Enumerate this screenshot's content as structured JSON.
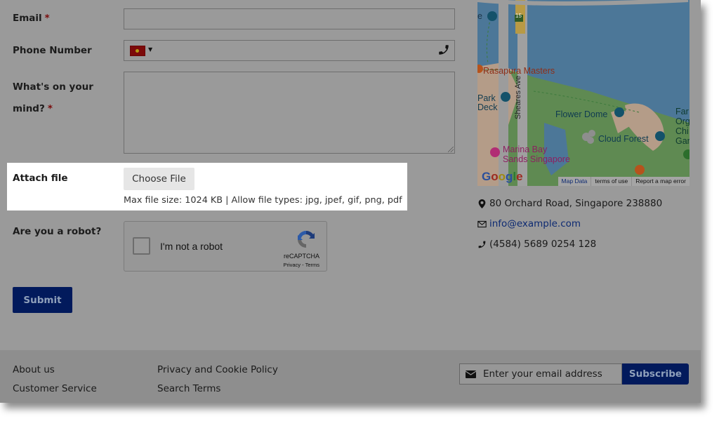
{
  "form": {
    "email": {
      "label": "Email",
      "required_mark": "*",
      "value": ""
    },
    "phone": {
      "label": "Phone Number",
      "country_flag": "vietnam-flag",
      "value": ""
    },
    "message": {
      "label_line1": "What's on your",
      "label_line2": "mind?",
      "required_mark": "*",
      "value": ""
    },
    "attach": {
      "label": "Attach file",
      "button_label": "Choose File",
      "hint": "Max file size: 1024 KB | Allow file types: jpg, jpef, gif, png, pdf"
    },
    "robot": {
      "label": "Are you a robot?",
      "checkbox_label": "I'm not a robot",
      "brand": "reCAPTCHA",
      "links": "Privacy - Terms",
      "checked": false
    },
    "submit_label": "Submit"
  },
  "map": {
    "labels": {
      "rasapura": "Rasapura Masters",
      "park_deck_1": "Park",
      "park_deck_2": "Deck",
      "sheares": "Sheares Ave",
      "flower_dome": "Flower Dome",
      "cloud_forest": "Cloud Forest",
      "marina_1": "Marina Bay",
      "marina_2": "Sands Singapore",
      "far_1": "Far",
      "far_2": "Org",
      "far_3": "Chi",
      "far_4": "Gar",
      "edge_e": "e",
      "route": "15"
    },
    "logo": "Google",
    "footer_links": [
      "Map Data",
      "terms of use",
      "Report a map error"
    ]
  },
  "contact": {
    "address": "80 Orchard Road, Singapore 238880",
    "email": "info@example.com",
    "phone": "(4584) 5689 0254 128"
  },
  "footer": {
    "links_col1": [
      "About us",
      "Customer Service"
    ],
    "links_col2": [
      "Privacy and Cookie Policy",
      "Search Terms"
    ],
    "newsletter": {
      "placeholder": "Enter your email address",
      "button_label": "Subscribe"
    }
  },
  "colors": {
    "accent": "#021a5c",
    "required": "#7a0b0b",
    "overlay": "#9a9a9a"
  }
}
